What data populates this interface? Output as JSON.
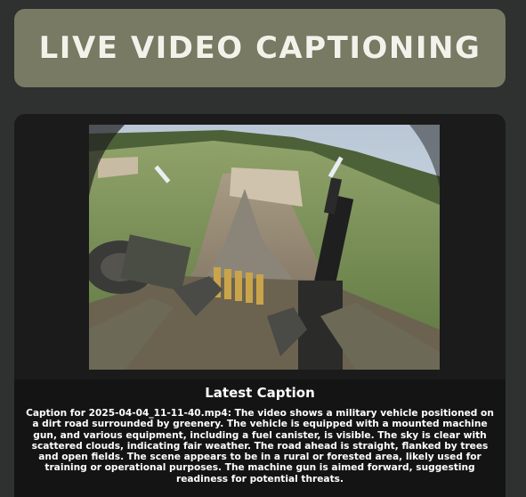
{
  "header": {
    "title": "LIVE VIDEO CAPTIONING"
  },
  "caption": {
    "heading": "Latest Caption",
    "text": "Caption for 2025-04-04_11-11-40.mp4: The video shows a military vehicle positioned on a dirt road surrounded by greenery. The vehicle is equipped with a mounted machine gun, and various equipment, including a fuel canister, is visible. The sky is clear with scattered clouds, indicating fair weather. The road ahead is straight, flanked by trees and open fields. The scene appears to be in a rural or forested area, likely used for training or operational purposes. The machine gun is aimed forward, suggesting readiness for potential threats."
  },
  "colors": {
    "background": "#2f3030",
    "header_bg": "#787a63",
    "panel_bg": "#1b1b1b",
    "caption_bg": "#141414",
    "text": "#ffffff"
  }
}
